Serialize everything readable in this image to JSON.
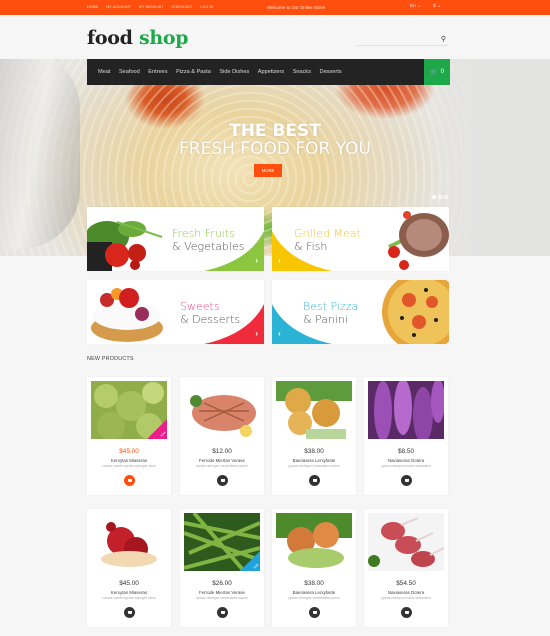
{
  "topbar": {
    "links": [
      "Home",
      "My Account",
      "My Wishlist",
      "Checkout",
      "Log In"
    ],
    "welcome": "Welcome to Our Online Store!",
    "language": "En",
    "currency": "$"
  },
  "header": {
    "logo_part1": "food",
    "logo_part2": "shop",
    "search_placeholder": "",
    "search_icon": "search-icon"
  },
  "nav": {
    "items": [
      "Meat",
      "Seafood",
      "Entrees",
      "Pizza & Pasta",
      "Side Dishes",
      "Appetizers",
      "Snacks",
      "Desserts"
    ],
    "cart_count": "0",
    "cart_icon": "cart-icon"
  },
  "hero": {
    "line1": "THE BEST",
    "line2": "FRESH FOOD FOR YOU",
    "button": "More",
    "slides": 3,
    "active_slide": 1
  },
  "banners": [
    {
      "title": "Fresh Fruits",
      "subtitle": "& Vegetables",
      "color": "#8cc63f",
      "arrow": "›"
    },
    {
      "title": "Grilled Meat",
      "subtitle": "& Fish",
      "color": "#f7c600",
      "arrow": "‹"
    },
    {
      "title": "Sweets",
      "subtitle": "& Desserts",
      "color": "#ef2b3c",
      "arrow": "›"
    },
    {
      "title": "Best Pizza",
      "subtitle": "& Panini",
      "color": "#2bb3d6",
      "arrow": "‹"
    }
  ],
  "section_title": "New Products",
  "products": [
    {
      "price": "$45.00",
      "name": "Kerxytas Miaseras",
      "desc": "cosdas scaete rlgeras miamgoe siena",
      "badge": "New",
      "sale": true
    },
    {
      "price": "$12.00",
      "name": "Ferrode Miertas Verase",
      "desc": "aptras ctermgse versaedstes scaete",
      "badge": "",
      "sale": false
    },
    {
      "price": "$38.00",
      "name": "Baeriasera Lerxyfaste",
      "desc": "ypsras ctermgse versaedstes sicene",
      "badge": "",
      "sale": false
    },
    {
      "price": "$8.50",
      "name": "Naxiaseras Dotera",
      "desc": "ypsras mtempsa nivdes stdeshiaria",
      "badge": "",
      "sale": false
    },
    {
      "price": "$45.00",
      "name": "Kerxytas Miaseras",
      "desc": "cosdas scaete rlgeras miamgoe siena",
      "badge": "",
      "sale": false
    },
    {
      "price": "$26.00",
      "name": "Ferrode Miertas Verase",
      "desc": "aptras ctermgse versaedstes scaete",
      "badge": "Sale",
      "sale": false
    },
    {
      "price": "$38.00",
      "name": "Baeriasera Lerxyfaste",
      "desc": "ypsras ctermgse versaedstes sicene",
      "badge": "",
      "sale": false
    },
    {
      "price": "$54.50",
      "name": "Naxiaseras Dotera",
      "desc": "ypsras mtempsa nivdes stdeshiaria",
      "badge": "",
      "sale": false
    }
  ]
}
